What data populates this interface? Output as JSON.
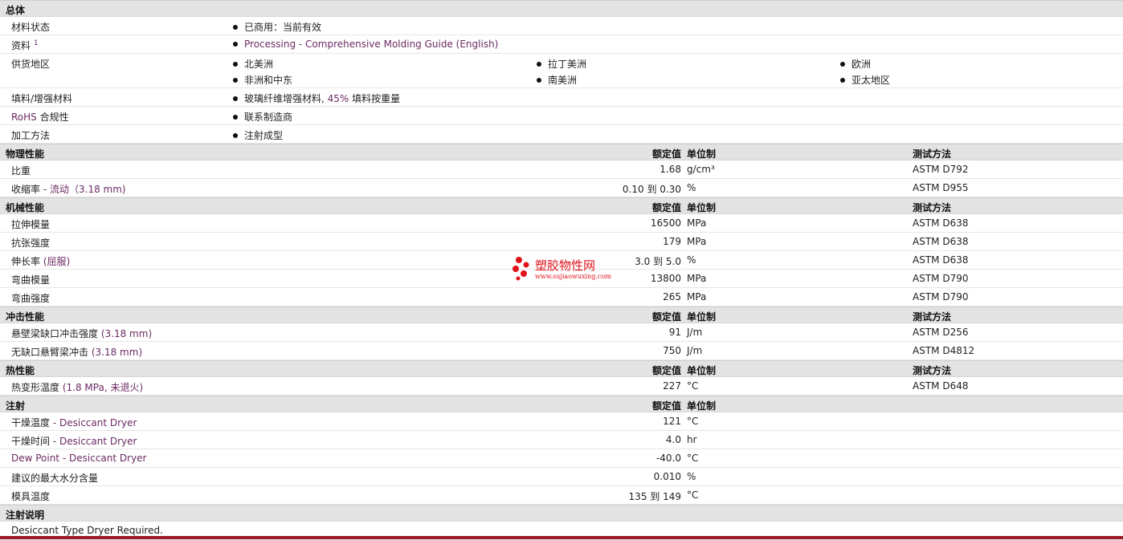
{
  "sections": {
    "general": {
      "title": "总体",
      "material_status": {
        "label": "材料状态",
        "value": "已商用：当前有效"
      },
      "literature": {
        "label": "资料",
        "sup": "1",
        "link": "Processing - Comprehensive Molding Guide (English)"
      },
      "availability": {
        "label": "供货地区",
        "regions": [
          "北美洲",
          "拉丁美洲",
          "欧洲",
          "非洲和中东",
          "南美洲",
          "亚太地区"
        ]
      },
      "filler": {
        "label": "填料/增强材料",
        "value_a": "玻璃纤维增强材料,",
        "value_b": "45%",
        "value_c": "填料按重量"
      },
      "rohs": {
        "label_a": "RoHS",
        "label_b": "合规性",
        "value": "联系制造商"
      },
      "processing": {
        "label": "加工方法",
        "value": "注射成型"
      }
    },
    "headers": {
      "nominal": "额定值",
      "unit": "单位制",
      "test": "测试方法"
    },
    "physical": {
      "title": "物理性能",
      "rows": [
        {
          "label": "比重",
          "cond": "",
          "value": "1.68",
          "unit": "g/cm³",
          "test": "ASTM D792"
        },
        {
          "label": "收缩率",
          "cond": "- 流动（3.18 mm)",
          "value": "0.10 到 0.30",
          "unit": "%",
          "test": "ASTM D955"
        }
      ]
    },
    "mechanical": {
      "title": "机械性能",
      "rows": [
        {
          "label": "拉伸模量",
          "cond": "",
          "value": "16500",
          "unit": "MPa",
          "test": "ASTM D638"
        },
        {
          "label": "抗张强度",
          "cond": "",
          "value": "179",
          "unit": "MPa",
          "test": "ASTM D638"
        },
        {
          "label": "伸长率",
          "cond": "(屈服)",
          "value": "3.0 到 5.0",
          "unit": "%",
          "test": "ASTM D638"
        },
        {
          "label": "弯曲模量",
          "cond": "",
          "value": "13800",
          "unit": "MPa",
          "test": "ASTM D790"
        },
        {
          "label": "弯曲强度",
          "cond": "",
          "value": "265",
          "unit": "MPa",
          "test": "ASTM D790"
        }
      ]
    },
    "impact": {
      "title": "冲击性能",
      "rows": [
        {
          "label": "悬壁梁缺口冲击强度",
          "cond": "(3.18 mm)",
          "value": "91",
          "unit": "J/m",
          "test": "ASTM D256"
        },
        {
          "label": "无缺口悬臂梁冲击",
          "cond": "(3.18 mm)",
          "value": "750",
          "unit": "J/m",
          "test": "ASTM D4812"
        }
      ]
    },
    "thermal": {
      "title": "热性能",
      "rows": [
        {
          "label": "热变形温度",
          "cond": "(1.8 MPa, 未退火)",
          "value": "227",
          "unit": "°C",
          "test": "ASTM D648"
        }
      ]
    },
    "injection": {
      "title": "注射",
      "rows": [
        {
          "label": "干燥温度",
          "cond": "- Desiccant Dryer",
          "value": "121",
          "unit": "°C"
        },
        {
          "label": "干燥时间",
          "cond": "- Desiccant Dryer",
          "value": "4.0",
          "unit": "hr"
        },
        {
          "label": "Dew Point - Desiccant Dryer",
          "cond": "",
          "value": "-40.0",
          "unit": "°C"
        },
        {
          "label": "建议的最大水分含量",
          "cond": "",
          "value": "0.010",
          "unit": "%"
        },
        {
          "label": "模具温度",
          "cond": "",
          "value": "135 到 149",
          "unit": "°C"
        }
      ]
    },
    "notes": {
      "title": "注射说明",
      "text": "Desiccant Type Dryer Required."
    }
  },
  "watermark": {
    "name": "塑胶物性网",
    "url": "www.sujiaowuxing.com"
  },
  "colors": {
    "header_bg": "#e3e3e3",
    "link": "#6b2b63",
    "footer_bar": "#9b1b28",
    "watermark": "#e0121a"
  }
}
